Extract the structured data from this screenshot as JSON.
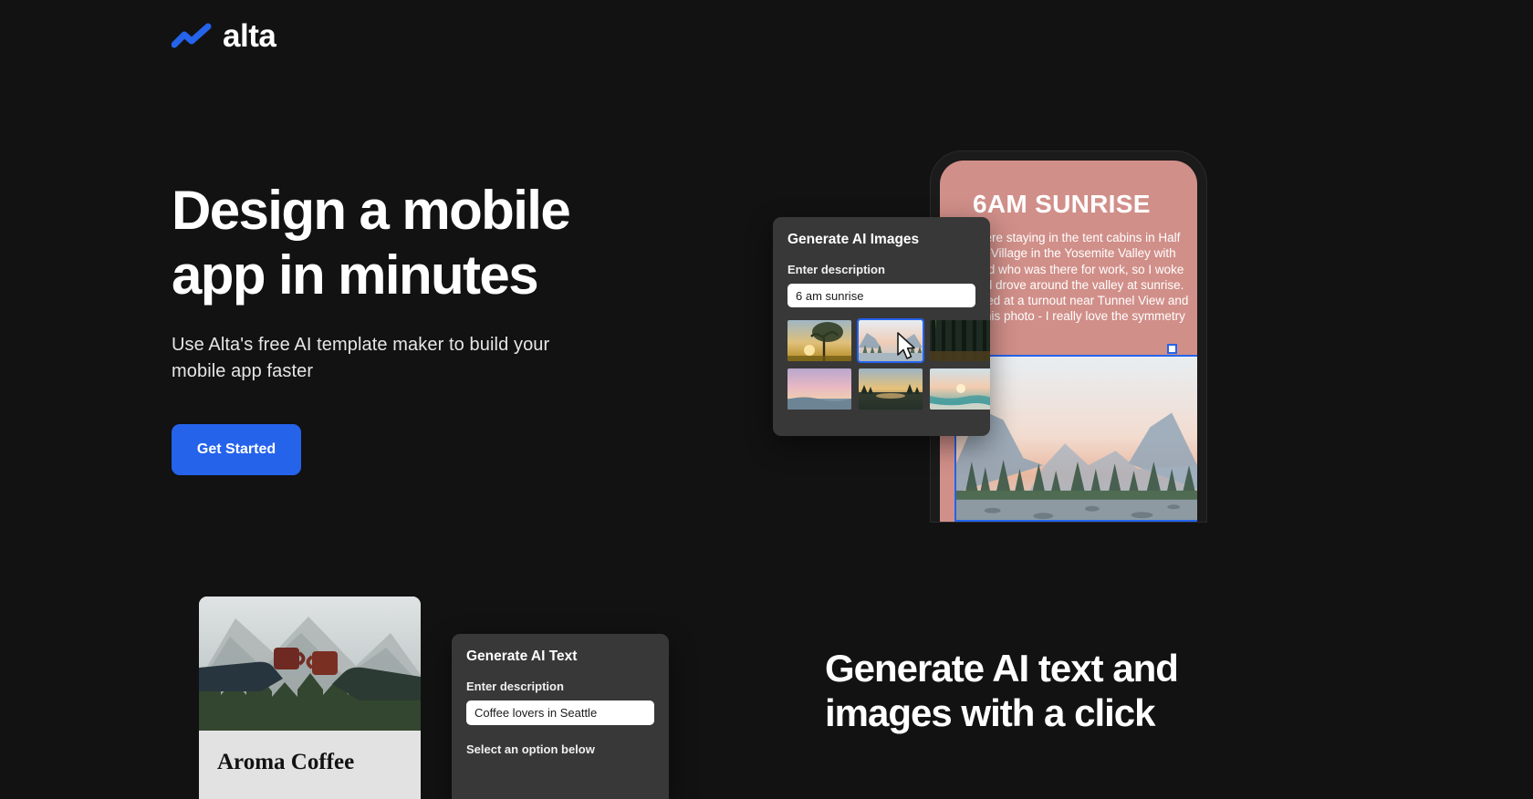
{
  "brand": {
    "name": "alta",
    "logo_icon": "zigzag-chart-icon",
    "accent_color": "#2563EB",
    "page_background": "#121212"
  },
  "hero": {
    "title": "Design a mobile\napp in minutes",
    "subtitle": "Use Alta's free AI template maker to build your\nmobile app faster",
    "cta_label": "Get Started"
  },
  "ai_images_panel": {
    "title": "Generate AI Images",
    "field_label": "Enter description",
    "input_value": "6 am sunrise",
    "input_placeholder": "Enter description",
    "thumbnails": [
      {
        "alt": "sunrise-through-tree",
        "selected": false
      },
      {
        "alt": "yosemite-valley-sunrise",
        "selected": true
      },
      {
        "alt": "sunbeams-in-forest",
        "selected": false
      },
      {
        "alt": "pink-sunrise-over-water",
        "selected": false
      },
      {
        "alt": "lake-reflection-sunrise",
        "selected": false
      },
      {
        "alt": "beach-sunrise",
        "selected": false
      }
    ],
    "cursor_icon": "mouse-pointer-icon"
  },
  "phone_preview": {
    "heading": "6AM SUNRISE",
    "body": "We were staying in the tent cabins in Half Dome Village in the Yosemite Valley with my dad who was there for work, so I woke up and drove around the valley at sunrise. Stopped at a turnout near Tunnel View and shot this photo - I really love the symmetry of it.",
    "photo_alt": "yosemite-valley-sunrise-photo",
    "selection_color": "#2563EB",
    "screen_background": "#D18F89"
  },
  "coffee_card": {
    "image_alt": "two-people-toasting-coffee-mugs",
    "title": "Aroma Coffee"
  },
  "ai_text_panel": {
    "title": "Generate AI Text",
    "field_label": "Enter description",
    "input_value": "Coffee lovers in Seattle",
    "input_placeholder": "Enter description",
    "option_label": "Select an option below"
  },
  "bottom_section": {
    "title": "Generate AI text and\nimages with a click"
  }
}
